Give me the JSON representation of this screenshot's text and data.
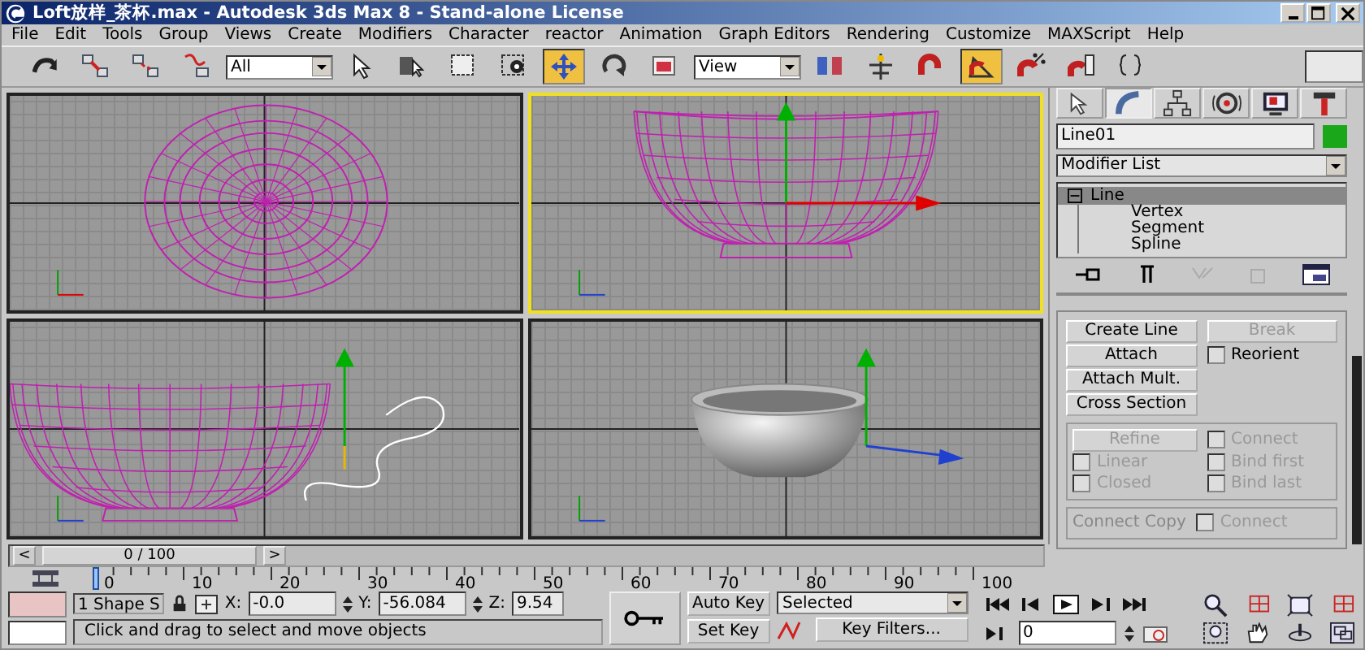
{
  "window": {
    "title": "Loft放样_茶杯.max - Autodesk 3ds Max 8  - Stand-alone License"
  },
  "menu": [
    "File",
    "Edit",
    "Tools",
    "Group",
    "Views",
    "Create",
    "Modifiers",
    "Character",
    "reactor",
    "Animation",
    "Graph Editors",
    "Rendering",
    "Customize",
    "MAXScript",
    "Help"
  ],
  "toolbar": [
    {
      "kind": "tool",
      "selected": false
    },
    {
      "kind": "tool",
      "selected": false
    },
    {
      "kind": "tool",
      "selected": false
    },
    {
      "kind": "tool",
      "selected": false
    },
    {
      "kind": "dropdown",
      "value": "All"
    },
    {
      "kind": "tool",
      "selected": false
    },
    {
      "kind": "tool",
      "selected": false
    },
    {
      "kind": "tool",
      "selected": false
    },
    {
      "kind": "tool",
      "selected": false
    },
    {
      "kind": "tool",
      "selected": true
    },
    {
      "kind": "tool",
      "selected": false
    },
    {
      "kind": "tool",
      "selected": false
    },
    {
      "kind": "dropdown",
      "value": "View"
    },
    {
      "kind": "tool",
      "selected": false
    },
    {
      "kind": "tool",
      "selected": false
    },
    {
      "kind": "tool",
      "selected": false
    },
    {
      "kind": "tool",
      "selected": true
    },
    {
      "kind": "tool",
      "selected": false
    },
    {
      "kind": "tool",
      "selected": false
    },
    {
      "kind": "tool",
      "selected": false
    }
  ],
  "viewports": [
    {
      "selected": false
    },
    {
      "selected": true
    },
    {
      "selected": false
    },
    {
      "selected": false
    }
  ],
  "command_panel": {
    "tabs": [
      {
        "selected": false
      },
      {
        "selected": true
      },
      {
        "selected": false
      },
      {
        "selected": false
      },
      {
        "selected": false
      },
      {
        "selected": false
      }
    ],
    "object": {
      "name": "Line01",
      "color": "#1aa81a"
    },
    "modifier_list": "Modifier List",
    "stack": [
      {
        "label": "Line",
        "selected": true,
        "expanded": true,
        "children": [
          {
            "label": "Vertex"
          },
          {
            "label": "Segment"
          },
          {
            "label": "Spline"
          }
        ]
      }
    ],
    "left_buttons": [
      {
        "label": "Create Line",
        "disabled": false
      },
      {
        "label": "Attach",
        "disabled": false
      },
      {
        "label": "Attach Mult.",
        "disabled": false
      },
      {
        "label": "Cross Section",
        "disabled": false
      }
    ],
    "break": {
      "label": "Break",
      "disabled": true
    },
    "reorient": {
      "label": "Reorient",
      "checked": false,
      "disabled": false
    },
    "refine": {
      "label": "Refine",
      "disabled": true
    },
    "refine_options": [
      {
        "label": "Connect",
        "checked": false,
        "disabled": true
      },
      {
        "label": "Linear",
        "checked": false,
        "disabled": true
      },
      {
        "label": "Bind first",
        "checked": false,
        "disabled": true
      },
      {
        "label": "Closed",
        "checked": false,
        "disabled": true
      },
      {
        "label": "Bind last",
        "checked": false,
        "disabled": true
      }
    ],
    "connect_copy": {
      "title": "Connect Copy",
      "options": [
        {
          "label": "Connect",
          "checked": false,
          "disabled": true
        }
      ]
    }
  },
  "time_slider": {
    "prev": "<",
    "label": "0 / 100",
    "next": ">",
    "level": 0
  },
  "ruler": [
    "0",
    "10",
    "20",
    "30",
    "40",
    "50",
    "60",
    "70",
    "80",
    "90",
    "100"
  ],
  "status": {
    "selection": "1 Shape S",
    "coords": [
      {
        "axis": "X:",
        "value": "-0.0"
      },
      {
        "axis": "Y:",
        "value": "-56.084"
      },
      {
        "axis": "Z:",
        "value": "9.54"
      }
    ],
    "prompt": "Click and drag to select and move objects"
  },
  "keys": {
    "auto_key": {
      "label": "Auto Key",
      "on": false
    },
    "key_mode": "Selected",
    "set_key": "Set Key",
    "key_filters": "Key Filters..."
  },
  "frame": "0"
}
